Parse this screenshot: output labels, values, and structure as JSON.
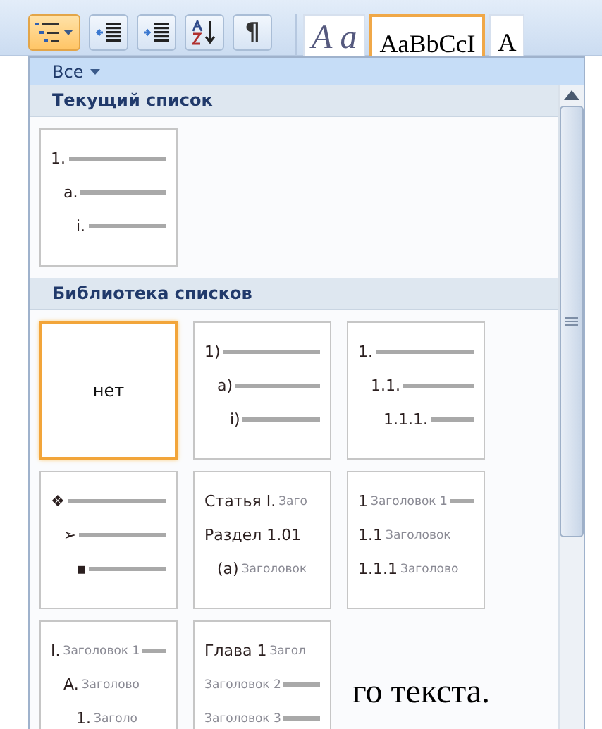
{
  "ribbon": {
    "buttons": [
      {
        "kind": "multilevel",
        "selected": true
      },
      {
        "kind": "decrease-indent",
        "selected": false
      },
      {
        "kind": "increase-indent",
        "selected": false
      },
      {
        "kind": "sort",
        "selected": false
      },
      {
        "kind": "pilcrow",
        "label": "¶",
        "selected": false
      }
    ],
    "styles": [
      {
        "sample": "A a",
        "selected": false
      },
      {
        "sample": "AaBbCcI",
        "selected": true
      },
      {
        "sample": "A",
        "selected": false
      }
    ]
  },
  "filter": {
    "label": "Все"
  },
  "sections": [
    {
      "title": "Текущий список",
      "tiles": [
        {
          "kind": "levels",
          "selected": false,
          "lines": [
            {
              "label": "1.",
              "rule": true,
              "children": [
                {
                  "label": "a.",
                  "rule": true,
                  "children": [
                    {
                      "label": "i.",
                      "rule": true
                    }
                  ]
                }
              ]
            }
          ]
        }
      ]
    },
    {
      "title": "Библиотека списков",
      "tiles": [
        {
          "kind": "none",
          "label": "нет",
          "selected": true
        },
        {
          "kind": "levels",
          "selected": false,
          "lines": [
            {
              "label": "1)",
              "rule": true,
              "children": [
                {
                  "label": "a)",
                  "rule": true,
                  "children": [
                    {
                      "label": "i)",
                      "rule": true
                    }
                  ]
                }
              ]
            }
          ]
        },
        {
          "kind": "levels",
          "selected": false,
          "lines": [
            {
              "label": "1.",
              "rule": true,
              "children": [
                {
                  "label": "1.1.",
                  "rule": true,
                  "children": [
                    {
                      "label": "1.1.1.",
                      "rule": true
                    }
                  ]
                }
              ]
            }
          ]
        },
        {
          "kind": "levels",
          "selected": false,
          "lines": [
            {
              "label": "❖",
              "rule": true,
              "children": [
                {
                  "label": "➢",
                  "rule": true,
                  "children": [
                    {
                      "label": "▪",
                      "rule": true
                    }
                  ]
                }
              ]
            }
          ]
        },
        {
          "kind": "levels",
          "selected": false,
          "lines": [
            {
              "label": "Статья I.",
              "text": "Заго",
              "rule": false
            },
            {
              "label": "Раздел 1.01",
              "rule": false,
              "children": [
                {
                  "label": "(a)",
                  "text": "Заголовок",
                  "rule": false
                }
              ]
            }
          ]
        },
        {
          "kind": "levels",
          "selected": false,
          "lines": [
            {
              "label": "1",
              "text": "Заголовок 1",
              "rule": true
            },
            {
              "label": "1.1",
              "text": "Заголовок",
              "rule": false
            },
            {
              "label": "1.1.1",
              "text": "Заголово",
              "rule": false
            }
          ]
        },
        {
          "kind": "levels",
          "selected": false,
          "lines": [
            {
              "label": "I.",
              "text": "Заголовок 1",
              "rule": true,
              "children": [
                {
                  "label": "A.",
                  "text": "Заголово",
                  "rule": false,
                  "children": [
                    {
                      "label": "1.",
                      "text": "Заголо",
                      "rule": false
                    }
                  ]
                }
              ]
            }
          ]
        },
        {
          "kind": "levels",
          "selected": false,
          "lines": [
            {
              "label": "Глава 1",
              "text": "Загол",
              "rule": false
            },
            {
              "text": "Заголовок 2",
              "rule": true
            },
            {
              "text": "Заголовок 3",
              "rule": true
            }
          ]
        }
      ]
    }
  ],
  "document_text": "го текста."
}
